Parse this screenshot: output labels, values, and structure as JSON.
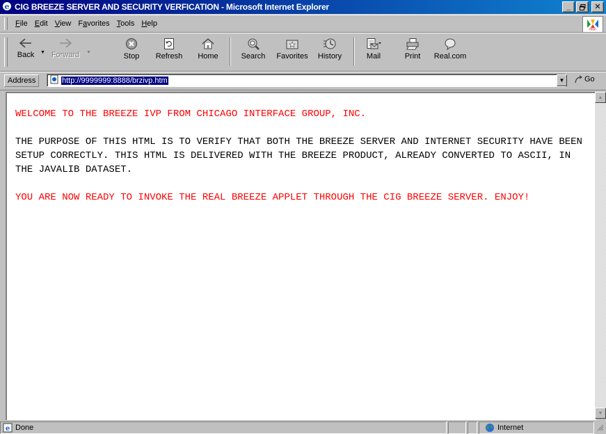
{
  "window": {
    "title": "CIG BREEZE SERVER AND SECURITY VERFICATION - Microsoft Internet Explorer",
    "controls": {
      "minimize": "_",
      "maximize": "□",
      "close": "✕"
    }
  },
  "menu": {
    "items": [
      {
        "label": "File",
        "accel": "F"
      },
      {
        "label": "Edit",
        "accel": "E"
      },
      {
        "label": "View",
        "accel": "V"
      },
      {
        "label": "Favorites",
        "accel": "a"
      },
      {
        "label": "Tools",
        "accel": "T"
      },
      {
        "label": "Help",
        "accel": "H"
      }
    ]
  },
  "toolbar": {
    "back": "Back",
    "forward": "Forward",
    "stop": "Stop",
    "refresh": "Refresh",
    "home": "Home",
    "search": "Search",
    "favorites": "Favorites",
    "history": "History",
    "mail": "Mail",
    "print": "Print",
    "realcom": "Real.com"
  },
  "address": {
    "label": "Address",
    "url": "http://9999999:8888/brzivp.htm",
    "go": "Go"
  },
  "page": {
    "welcome": "WELCOME TO THE BREEZE IVP FROM CHICAGO INTERFACE GROUP, INC.",
    "purpose": "THE PURPOSE OF THIS HTML IS TO VERIFY THAT BOTH THE BREEZE SERVER AND INTERNET SECURITY HAVE BEEN SETUP CORRECTLY. THIS HTML IS DELIVERED WITH THE BREEZE PRODUCT, ALREADY CONVERTED TO ASCII, IN THE JAVALIB DATASET.",
    "ready": "YOU ARE NOW READY TO INVOKE THE REAL BREEZE APPLET THROUGH THE CIG BREEZE SERVER. ENJOY!",
    "colors": {
      "highlight": "#ff0000",
      "body": "#000000"
    }
  },
  "status": {
    "text": "Done",
    "zone": "Internet"
  }
}
